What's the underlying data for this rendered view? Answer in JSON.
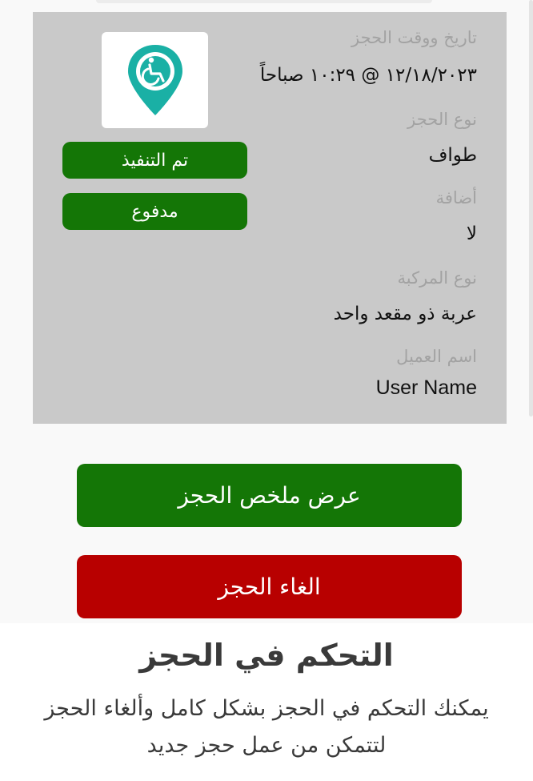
{
  "booking": {
    "date_label": "تاريخ ووقت الحجز",
    "date_value": "١٢/١٨/٢٠٢٣ @ ١٠:٢٩ صباحاً",
    "type_label": "نوع الحجز",
    "type_value": "طواف",
    "extra_label": "أضافة",
    "extra_value": "لا",
    "vehicle_label": "نوع المركبة",
    "vehicle_value": "عربة ذو مقعد واحد",
    "customer_label": "اسم العميل",
    "customer_value": "User Name"
  },
  "logo": {
    "icon": "wheelchair-location-pin-icon",
    "color": "#1ab0a5"
  },
  "status": {
    "executed": "تم التنفيذ",
    "paid": "مدفوع",
    "badge_color": "#147606"
  },
  "actions": {
    "view_summary": "عرض ملخص الحجز",
    "view_summary_color": "#147606",
    "cancel": "الغاء الحجز",
    "cancel_color": "#b80000"
  },
  "promo": {
    "title": "التحكم في الحجز",
    "description": "يمكنك التحكم في الحجز بشكل كامل وألغاء الحجز لتتمكن من عمل حجز جديد"
  }
}
